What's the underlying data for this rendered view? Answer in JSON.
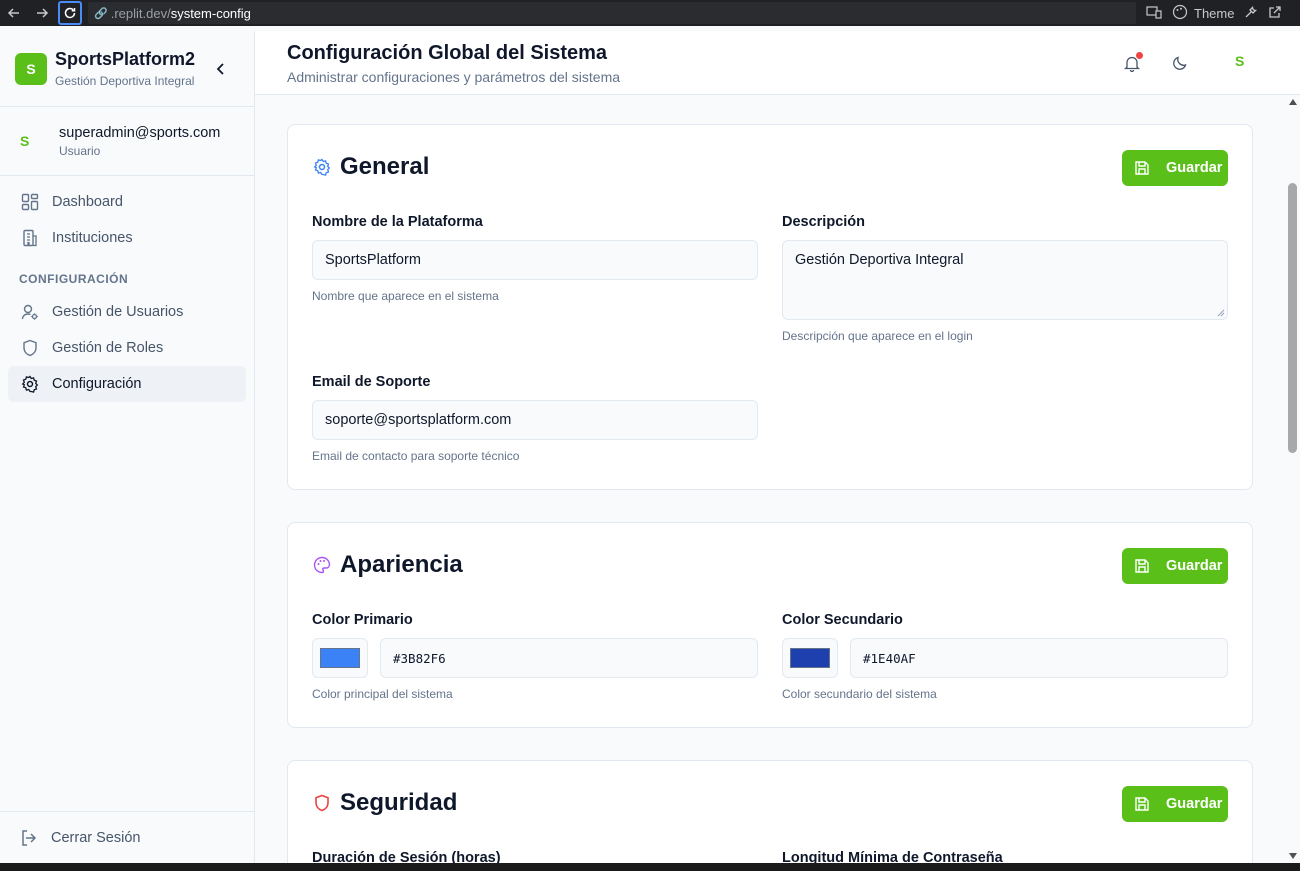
{
  "browser": {
    "url_prefix": ".replit.dev/",
    "url_path": "system-config",
    "theme_label": "Theme"
  },
  "sidebar": {
    "brand_initial": "S",
    "brand_name": "SportsPlatform2",
    "brand_subtitle": "Gestión Deportiva Integral",
    "user_initial": "S",
    "user_email": "superadmin@sports.com",
    "user_role": "Usuario",
    "main_items": [
      {
        "label": "Dashboard",
        "icon": "dashboard-icon"
      },
      {
        "label": "Instituciones",
        "icon": "building-icon"
      }
    ],
    "section_label": "CONFIGURACIÓN",
    "config_items": [
      {
        "label": "Gestión de Usuarios",
        "icon": "user-gear-icon"
      },
      {
        "label": "Gestión de Roles",
        "icon": "shield-icon"
      },
      {
        "label": "Configuración",
        "icon": "gear-icon",
        "active": true
      }
    ],
    "logout_label": "Cerrar Sesión"
  },
  "header": {
    "title": "Configuración Global del Sistema",
    "subtitle": "Administrar configuraciones y parámetros del sistema",
    "avatar_initial": "S"
  },
  "cards": {
    "general": {
      "title": "General",
      "save_label": "Guardar",
      "platform_name": {
        "label": "Nombre de la Plataforma",
        "value": "SportsPlatform",
        "help": "Nombre que aparece en el sistema"
      },
      "description": {
        "label": "Descripción",
        "value": "Gestión Deportiva Integral",
        "help": "Descripción que aparece en el login"
      },
      "support_email": {
        "label": "Email de Soporte",
        "value": "soporte@sportsplatform.com",
        "help": "Email de contacto para soporte técnico"
      }
    },
    "appearance": {
      "title": "Apariencia",
      "save_label": "Guardar",
      "primary": {
        "label": "Color Primario",
        "value": "#3B82F6",
        "help": "Color principal del sistema"
      },
      "secondary": {
        "label": "Color Secundario",
        "value": "#1E40AF",
        "help": "Color secundario del sistema"
      }
    },
    "security": {
      "title": "Seguridad",
      "save_label": "Guardar",
      "session_duration_label": "Duración de Sesión (horas)",
      "min_password_label": "Longitud Mínima de Contraseña"
    }
  },
  "colors": {
    "accent_green": "#5bbf1a",
    "general_icon": "#3b82f6",
    "appearance_icon": "#a855f7",
    "security_icon": "#ef4444"
  }
}
